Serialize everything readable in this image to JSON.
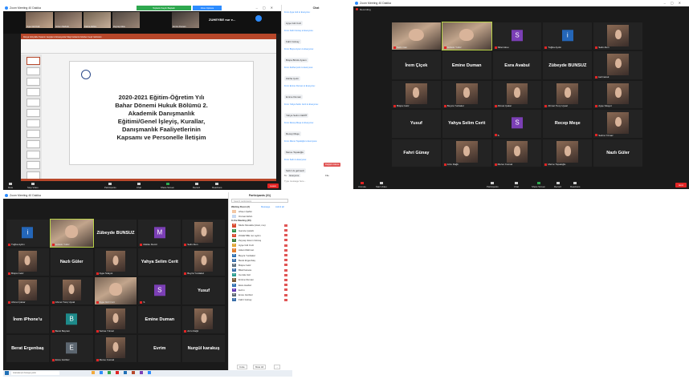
{
  "colors": {
    "accent": "#2d8cff",
    "end": "#e02424",
    "highlight": "#b9d34a",
    "ppt": "#b7472a"
  },
  "win1": {
    "title": "Zoom Meeting 40 Dakika",
    "green_tab": "Toplantı Kaydı Başladı",
    "blue_tab": "View Options",
    "speaker_label": "ZUHEYBE nur e...",
    "ppt_tab_labels": "Dosya  Giriş  Ekle  Tasarım  Geçişler  Animasyonlar  Slayt Gösterisi  Gözden Geçir  Görünüm",
    "slide_title": "2020-2021 Eğitim-Öğretim Yılı\nBahar Dönemi Hukuk Bölümü 2.\nAkademik Danışmanlık\nEğitimi/Genel İşleyiş, Kurallar,\nDanışmanlık Faaliyetlerinin\nKapsamı ve Personelle İletişim",
    "toolbar": [
      "Mute",
      "Stop Video",
      "Participants",
      "Chat",
      "Share Screen",
      "Record",
      "Reactions"
    ],
    "end_label": "Leave",
    "chat": {
      "title": "Chat",
      "items": [
        {
          "from": "From Ayşe Gül to Everyone:",
          "msg": "Ayşe Gül Cıvit"
        },
        {
          "from": "From Fahri Günay to Everyone:",
          "msg": "Fahri Günay"
        },
        {
          "from": "From Büşra Aytem to Everyone:",
          "msg": "Büşra Biricik Aytem"
        },
        {
          "from": "From Zeliha Çetin to Everyone:",
          "msg": "Zeliha Çetin"
        },
        {
          "from": "From Emine Duman to Everyone:",
          "msg": "Emine Duman"
        },
        {
          "from": "From Yahya Selim Cerit to Everyone:",
          "msg": "Yahya Selim CERİT"
        },
        {
          "from": "From Recep Meşe to Everyone:",
          "msg": "Recep Meşe"
        },
        {
          "from": "From Merve Topaloğlu to Everyone:",
          "msg": "Merve Topaloğlu"
        },
        {
          "from": "From Selin to Everyone:",
          "msg": "Selin Us gelmedi"
        }
      ],
      "to_label": "To:",
      "to_value": "Everyone",
      "file_label": "File",
      "send_button": "Değiştir ödeme",
      "input_placeholder": "Type message here..."
    },
    "thumbnails": [
      "Ayşe Gül Cıvit",
      "Gizem Mahnık",
      "Fatma Zehra",
      "Zeynep Aksu",
      "Emine Duman"
    ]
  },
  "win2": {
    "title": "Zoom Meeting 40 Dakika",
    "recording": "Recording",
    "tiles": [
      {
        "label": "Selin Can",
        "kind": "cam"
      },
      {
        "label": "Gülsün Yıldız",
        "kind": "cam",
        "hl": true
      },
      {
        "label": "Sibel Aksu",
        "kind": "avatar",
        "letter": "S",
        "color": "#7b3fb5"
      },
      {
        "label": "Tuğba Aydın",
        "kind": "avatar",
        "letter": "i",
        "color": "#2466b8"
      },
      {
        "label": "Selin Akın",
        "kind": "photo"
      },
      {
        "label": "İrem Çiçek",
        "kind": "text"
      },
      {
        "label": "Emine Duman",
        "kind": "text"
      },
      {
        "label": "Esra Avabul",
        "kind": "text"
      },
      {
        "label": "Zübeyde BUNSUZ",
        "kind": "text"
      },
      {
        "label": "kerimarek",
        "kind": "photo"
      },
      {
        "label": "Büşra Cetiz",
        "kind": "photo"
      },
      {
        "label": "Beyza Yurdakul",
        "kind": "photo"
      },
      {
        "label": "Ahmet Çakar",
        "kind": "photo"
      },
      {
        "label": "Ahmet Tunç Uysal",
        "kind": "photo"
      },
      {
        "label": "Ayşe Sılayot",
        "kind": "photo"
      },
      {
        "label": "Yusuf",
        "kind": "text"
      },
      {
        "label": "Yahya Selim Cerit",
        "kind": "text"
      },
      {
        "label": "S",
        "kind": "avatar",
        "letter": "S",
        "color": "#7b3fb5"
      },
      {
        "label": "Recep Meşe",
        "kind": "text"
      },
      {
        "label": "Selma Yılmaz",
        "kind": "photo"
      },
      {
        "label": "Fahri Günay",
        "kind": "text"
      },
      {
        "label": "Arzu Dağlı",
        "kind": "photo"
      },
      {
        "label": "Merve Cumalı",
        "kind": "photo"
      },
      {
        "label": "Merve Topaloğlu",
        "kind": "photo"
      },
      {
        "label": "Nazlı Güler",
        "kind": "text"
      }
    ],
    "toolbar": [
      "Unmute",
      "Start Video",
      "Participants",
      "Chat",
      "Share Screen",
      "Record",
      "Reactions"
    ],
    "end_label": "End"
  },
  "win3": {
    "title": "Zoom Meeting 40 Dakika",
    "tiles": [
      {
        "label": "Tuğba Aydın",
        "kind": "avatar",
        "letter": "i",
        "color": "#2466b8"
      },
      {
        "label": "Gülsün Yıldız",
        "kind": "cam",
        "hl": true
      },
      {
        "label": "Zübeyde BUNSUZ",
        "kind": "text"
      },
      {
        "label": "Melike Demir",
        "kind": "avatar",
        "letter": "M",
        "color": "#7b3fb5"
      },
      {
        "label": "Selin Akın",
        "kind": "photo"
      },
      {
        "label": "Büşra Cetiz",
        "kind": "photo"
      },
      {
        "label": "Nazlı Güler",
        "kind": "text"
      },
      {
        "label": "Ayşe Sılayot",
        "kind": "photo"
      },
      {
        "label": "Yahya Selim Cerit",
        "kind": "text"
      },
      {
        "label": "Beyza Yurdakul",
        "kind": "photo"
      },
      {
        "label": "Ahmet Çakar",
        "kind": "photo"
      },
      {
        "label": "Ahmet Tunç Uysal",
        "kind": "photo"
      },
      {
        "label": "Ayşe Gül Cıvit",
        "kind": "cam"
      },
      {
        "label": "S",
        "kind": "avatar",
        "letter": "S",
        "color": "#7b3fb5"
      },
      {
        "label": "Yusuf",
        "kind": "text"
      },
      {
        "label": "İrem iPhone'u",
        "kind": "text"
      },
      {
        "label": "Berat Bayram",
        "kind": "avatar",
        "letter": "B",
        "color": "#1e8a8a"
      },
      {
        "label": "Selma Yılmaz",
        "kind": "photo"
      },
      {
        "label": "Emine Duman",
        "kind": "text"
      },
      {
        "label": "Arzu Dağlı",
        "kind": "photo"
      },
      {
        "label": "Berat Ergenbaş",
        "kind": "text"
      },
      {
        "label": "Emre Gürbüz",
        "kind": "avatar",
        "letter": "E",
        "color": "#5c6670"
      },
      {
        "label": "Merve Cumalı",
        "kind": "photo"
      },
      {
        "label": "Evrim",
        "kind": "text"
      },
      {
        "label": "Nurgül karakuş",
        "kind": "text"
      }
    ],
    "participants": {
      "title": "Participants (31)",
      "search_placeholder": "Search participants",
      "waiting_label": "Waiting Room (2)",
      "message_label": "Message",
      "admit_all_label": "Admit all",
      "waiting": [
        "Ahsen Şahin",
        "Osman Erkin"
      ],
      "in_meeting_label": "In the Meeting (30)",
      "members": [
        {
          "name": "Mutlu Mustafa (Host, me)",
          "letter": "M",
          "color": "#d94a2f"
        },
        {
          "name": "Gamze Çelebi",
          "letter": "G",
          "color": "#2f8f4a"
        },
        {
          "name": "ZUHEYBE nur aydın",
          "letter": "Z",
          "color": "#d94a2f"
        },
        {
          "name": "Zeynep Ecem Güneş",
          "letter": "Z",
          "color": "#3c7d3c"
        },
        {
          "name": "Ayşe Gül Cıvit",
          "letter": "A",
          "color": "#e0a32e"
        },
        {
          "name": "Aslan Mehmet",
          "letter": "A",
          "color": "#e07b2e"
        },
        {
          "name": "Beyza Yurdakul",
          "letter": "B",
          "color": "#2e6fb0"
        },
        {
          "name": "Berat Ergenbaş",
          "letter": "B",
          "color": "#3a6ea8"
        },
        {
          "name": "Büşra Cetiz",
          "letter": "B",
          "color": "#5b6b7a"
        },
        {
          "name": "Bilal Karaca",
          "letter": "B",
          "color": "#3a6ea8"
        },
        {
          "name": "Cemile Gül",
          "letter": "C",
          "color": "#2a9d8f"
        },
        {
          "name": "Emine Duman",
          "letter": "E",
          "color": "#7a5c3a"
        },
        {
          "name": "Esra Avabul",
          "letter": "E",
          "color": "#2e6fb0"
        },
        {
          "name": "Evrim",
          "letter": "E",
          "color": "#5e35b1"
        },
        {
          "name": "Emre Gürbüz",
          "letter": "E",
          "color": "#5c6670"
        },
        {
          "name": "Fahri Günay",
          "letter": "F",
          "color": "#3a6ea8"
        }
      ],
      "invite_button": "Invite",
      "mute_all_button": "Mute All",
      "more_button": "..."
    },
    "taskbar_search": "Aramak için buraya yazın"
  }
}
